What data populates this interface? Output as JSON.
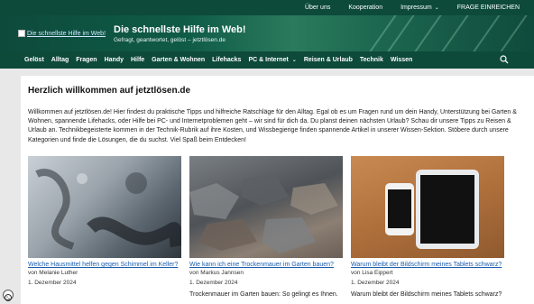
{
  "topbar": {
    "links": [
      {
        "label": "Über uns"
      },
      {
        "label": "Kooperation"
      },
      {
        "label": "Impressum",
        "has_dropdown": true
      },
      {
        "label": "FRAGE EINREICHEN"
      }
    ]
  },
  "header": {
    "logo_alt": "Die schnellste Hilfe im Web!",
    "title": "Die schnellste Hilfe im Web!",
    "tagline": "Gefragt, geantwortet, gelöst – jetztlösen.de"
  },
  "nav": {
    "items": [
      {
        "label": "Gelöst"
      },
      {
        "label": "Alltag"
      },
      {
        "label": "Fragen"
      },
      {
        "label": "Handy"
      },
      {
        "label": "Hilfe"
      },
      {
        "label": "Garten & Wohnen"
      },
      {
        "label": "Lifehacks"
      },
      {
        "label": "PC & Internet",
        "has_dropdown": true
      },
      {
        "label": "Reisen & Urlaub"
      },
      {
        "label": "Technik"
      },
      {
        "label": "Wissen"
      }
    ],
    "search_icon": "search-icon"
  },
  "main": {
    "heading": "Herzlich willkommen auf jetztlösen.de",
    "intro": "Willkommen auf jetztlösen.de! Hier findest du praktische Tipps und hilfreiche Ratschläge für den Alltag. Egal ob es um Fragen rund um dein Handy, Unterstützung bei Garten & Wohnen, spannende Lifehacks, oder Hilfe bei PC- und Internetproblemen geht – wir sind für dich da. Du planst deinen nächsten Urlaub? Schau dir unsere Tipps zu Reisen & Urlaub an. Technikbegeisterte kommen in der Technik-Rubrik auf ihre Kosten, und Wissbegierige finden spannende Artikel in unserer Wissen-Sektion. Stöbere durch unsere Kategorien und finde die Lösungen, die du suchst. Viel Spaß beim Entdecken!",
    "articles": [
      {
        "title": "Welche Hausmittel helfen gegen Schimmel im Keller?",
        "author": "von Melanie Luther",
        "date": "1. Dezember 2024",
        "excerpt": ""
      },
      {
        "title": "Wie kann ich eine Trockenmauer im Garten bauen?",
        "author": "von Markus Jannsen",
        "date": "1. Dezember 2024",
        "excerpt": "Trockenmauer im Garten bauen: So gelingt es Ihnen."
      },
      {
        "title": "Warum bleibt der Bildschirm meines Tablets schwarz?",
        "author": "von Lisa Eippert",
        "date": "1. Dezember 2024",
        "excerpt": "Warum bleibt der Bildschirm meines Tablets schwarz?"
      }
    ]
  },
  "cookie": {
    "icon": "cookie-icon"
  },
  "colors": {
    "brand_dark": "#0d4a3a",
    "link": "#1a5db0"
  }
}
